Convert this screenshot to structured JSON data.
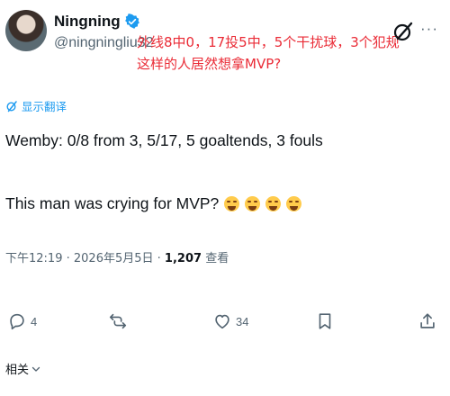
{
  "author": {
    "display_name": "Ningning",
    "handle": "@ningningliu32"
  },
  "overlay_caption": {
    "line1": "外线8中0，17投5中，5个干扰球，3个犯规",
    "line2": "这样的人居然想拿MVP?"
  },
  "translate_label": "显示翻译",
  "tweet": {
    "line1": "Wemby: 0/8 from 3, 5/17, 5 goaltends, 3 fouls",
    "line2": "This man was crying for MVP?"
  },
  "meta": {
    "time": "下午12:19",
    "date": "2026年5月5日",
    "views": "1,207",
    "views_label": "查看"
  },
  "actions": {
    "reply_count": "4",
    "like_count": "34"
  },
  "related_label": "相关",
  "colors": {
    "accent_blue": "#1d9bf0",
    "overlay_red": "#ea2b36",
    "muted": "#536471"
  }
}
